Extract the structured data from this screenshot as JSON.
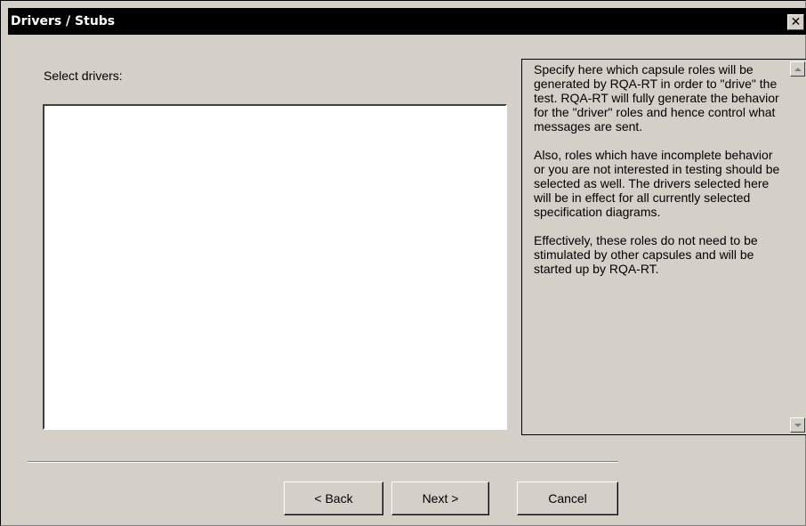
{
  "window": {
    "title": "Drivers / Stubs",
    "close_glyph": "✕"
  },
  "main": {
    "select_label": "Select drivers:",
    "drivers_list": []
  },
  "help": {
    "paragraphs": [
      "Specify here which capsule roles will be generated by RQA-RT in order to \"drive\" the test.  RQA-RT will fully generate the behavior for the \"driver\" roles and hence control what messages are sent.",
      "Also, roles which have incomplete behavior or you are not interested in testing should be selected as well. The drivers selected here will be in effect for all currently selected specification diagrams.",
      "Effectively, these roles do not need to be stimulated by other capsules and will be started up by RQA-RT."
    ]
  },
  "buttons": {
    "back_label": "< Back",
    "next_label": "Next >",
    "cancel_label": "Cancel"
  },
  "icons": {
    "close": "close-icon",
    "scroll_up": "scroll-up-arrow-icon",
    "scroll_down": "scroll-down-arrow-icon"
  },
  "colors": {
    "titlebar_bg": "#000000",
    "titlebar_text": "#ffffff",
    "dialog_bg": "#d4d0c8",
    "list_bg": "#ffffff"
  }
}
